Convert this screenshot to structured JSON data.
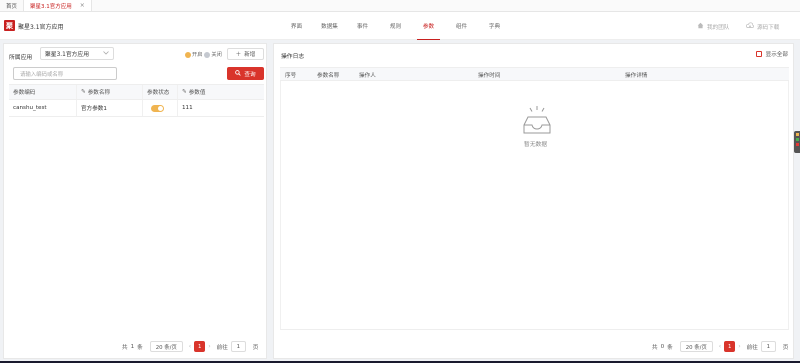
{
  "browser_tabs": [
    {
      "label": "首页",
      "active": false
    },
    {
      "label": "聚星3.1官方应用",
      "active": true,
      "close": "×"
    }
  ],
  "header": {
    "logo_text": "聚",
    "app_title": "聚星3.1官方应用",
    "nav": [
      {
        "label": "界面",
        "active": false
      },
      {
        "label": "数据集",
        "active": false
      },
      {
        "label": "事件",
        "active": false
      },
      {
        "label": "规则",
        "active": false
      },
      {
        "label": "参数",
        "active": true
      },
      {
        "label": "组件",
        "active": false
      },
      {
        "label": "字典",
        "active": false
      }
    ],
    "my_team": "我的团队",
    "source_download": "源码下载"
  },
  "left_panel": {
    "app_label": "所属应用",
    "app_select_value": "聚星3.1官方应用",
    "legend_on": "开启",
    "legend_off": "关闭",
    "add_button": "新增",
    "search_placeholder": "请输入编码或名称",
    "search_button": "查询",
    "columns": [
      "参数编码",
      "参数名称",
      "参数状态",
      "参数值"
    ],
    "rows": [
      {
        "code": "canshu_test",
        "name": "官方参数1",
        "enabled": true,
        "value": "111"
      }
    ],
    "pager": {
      "total_prefix": "共",
      "total": "1",
      "total_suffix": "条",
      "page_size": "20 条/页",
      "prev": "‹",
      "current": "1",
      "next": "›",
      "goto_label": "前往",
      "goto_value": "1",
      "page_suffix": "页"
    }
  },
  "right_panel": {
    "title": "操作日志",
    "show_all": "显示全部",
    "columns": [
      "序号",
      "参数名称",
      "操作人",
      "操作时间",
      "操作详情"
    ],
    "empty_text": "暂无数据",
    "pager": {
      "total_prefix": "共",
      "total": "0",
      "total_suffix": "条",
      "page_size": "20 条/页",
      "prev": "‹",
      "current": "1",
      "next": "›",
      "goto_label": "前往",
      "goto_value": "1",
      "page_suffix": "页"
    }
  },
  "colors": {
    "accent": "#d9342b",
    "switch_on": "#f0b450",
    "switch_off": "#c5c9d0"
  }
}
